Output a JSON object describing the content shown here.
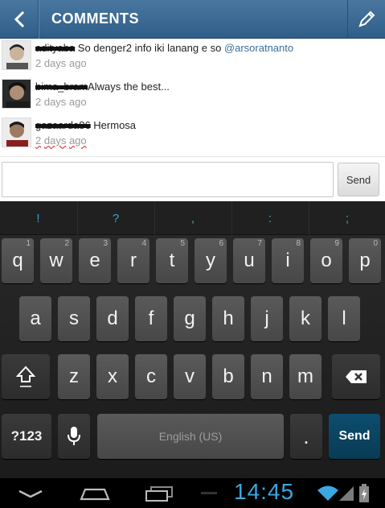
{
  "header": {
    "title": "COMMENTS",
    "back_icon": "chevron-left-icon",
    "edit_icon": "pencil-icon",
    "bg_color": "#3b6a95"
  },
  "comments": [
    {
      "username": "adityaba",
      "text": "So denger2 info iki lanang e so",
      "mention": "@arsoratnanto",
      "time": "2 days ago"
    },
    {
      "username": "bima_bram",
      "text": "Always the best...",
      "mention": "",
      "time": "2 days ago"
    },
    {
      "username": "gazaarda86",
      "text": "Hermosa",
      "mention": "",
      "time": "2 days ago",
      "time_parts": [
        "2",
        "days",
        "ago"
      ]
    }
  ],
  "input": {
    "placeholder": "",
    "send_label": "Send"
  },
  "keyboard": {
    "suggestions": [
      "!",
      "?",
      ",",
      ":",
      ";"
    ],
    "row1": [
      {
        "key": "q",
        "hint": "1"
      },
      {
        "key": "w",
        "hint": "2"
      },
      {
        "key": "e",
        "hint": "3"
      },
      {
        "key": "r",
        "hint": "4"
      },
      {
        "key": "t",
        "hint": "5"
      },
      {
        "key": "y",
        "hint": "6"
      },
      {
        "key": "u",
        "hint": "7"
      },
      {
        "key": "i",
        "hint": "8"
      },
      {
        "key": "o",
        "hint": "9"
      },
      {
        "key": "p",
        "hint": "0"
      }
    ],
    "row2": [
      "a",
      "s",
      "d",
      "f",
      "g",
      "h",
      "j",
      "k",
      "l"
    ],
    "row3": [
      "z",
      "x",
      "c",
      "v",
      "b",
      "n",
      "m"
    ],
    "symbols_label": "?123",
    "space_label": "English (US)",
    "period_label": ".",
    "send_label": "Send",
    "accent_color": "#3da1d8"
  },
  "status": {
    "time": "14:45"
  }
}
